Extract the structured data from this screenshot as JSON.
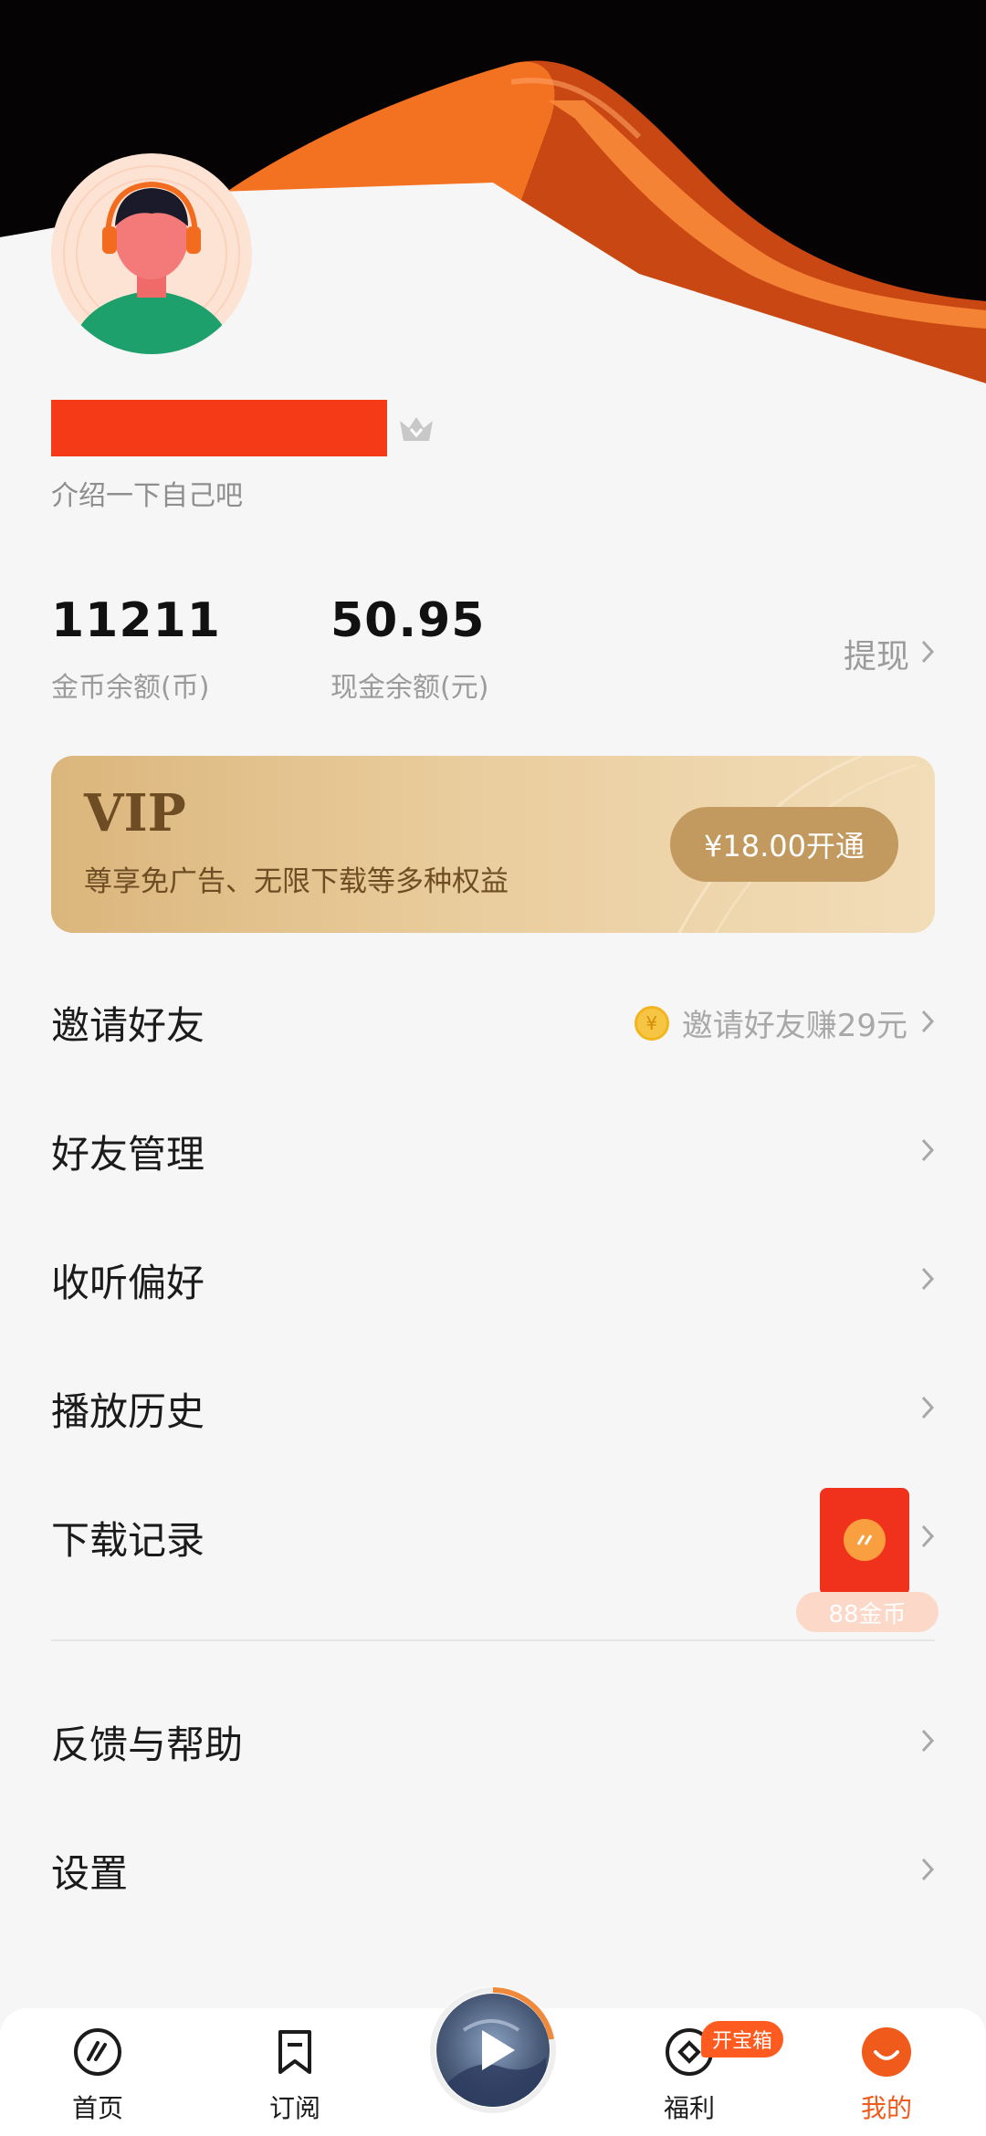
{
  "profile": {
    "bio": "介绍一下自己吧"
  },
  "stats": {
    "coins": {
      "value": "11211",
      "label": "金币余额(币)"
    },
    "cash": {
      "value": "50.95",
      "label": "现金余额(元)"
    },
    "withdraw_label": "提现"
  },
  "vip": {
    "title": "VIP",
    "description": "尊享免广告、无限下载等多种权益",
    "button": "¥18.00开通"
  },
  "menu": {
    "items": [
      {
        "label": "邀请好友",
        "extra": "邀请好友赚29元"
      },
      {
        "label": "好友管理"
      },
      {
        "label": "收听偏好"
      },
      {
        "label": "播放历史"
      },
      {
        "label": "下载记录"
      },
      {
        "label": "反馈与帮助"
      },
      {
        "label": "设置"
      }
    ],
    "red_packet_reward": "88金币"
  },
  "tabbar": {
    "tabs": [
      {
        "label": "首页",
        "icon": "home-icon"
      },
      {
        "label": "订阅",
        "icon": "bookmark-icon"
      },
      {
        "label": "福利",
        "icon": "welfare-icon"
      },
      {
        "label": "我的",
        "icon": "profile-icon",
        "active": true
      }
    ],
    "treasure_badge": "开宝箱"
  },
  "colors": {
    "accent": "#f05a1a",
    "vip_gold": "#c29a60",
    "redaction": "#f53a17"
  }
}
